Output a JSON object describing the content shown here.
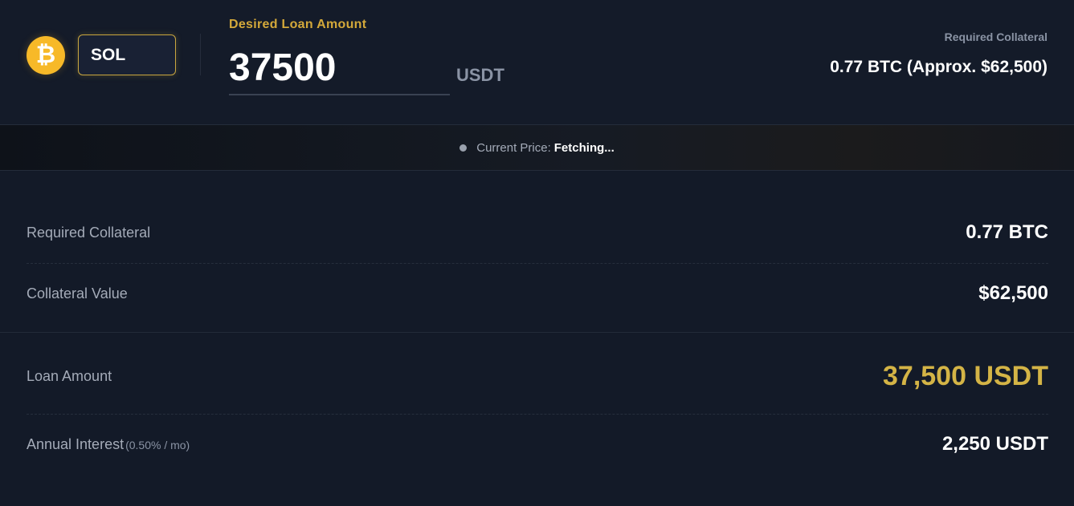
{
  "header": {
    "coin_icon_glyph": "₿",
    "coin_icon": "bitcoin-icon",
    "coin_selected": "SOL",
    "loan_label": "Desired Loan Amount",
    "loan_amount_value": "37500",
    "loan_currency": "USDT",
    "required_collateral_label": "Required Collateral",
    "required_collateral_value": "0.77 BTC (Approx. $62,500)"
  },
  "price_bar": {
    "label": "Current Price:",
    "value": "Fetching..."
  },
  "details": {
    "required_collateral": {
      "label": "Required Collateral",
      "value": "0.77 BTC"
    },
    "collateral_value": {
      "label": "Collateral Value",
      "value": "$62,500"
    },
    "loan_amount": {
      "label": "Loan Amount",
      "value": "37,500 USDT"
    },
    "annual_interest": {
      "label": "Annual Interest",
      "sub": "(0.50% / mo)",
      "value": "2,250 USDT"
    }
  },
  "colors": {
    "accent_gold": "#d4b446",
    "background": "#131a28",
    "bitcoin_orange": "#f7b928"
  }
}
